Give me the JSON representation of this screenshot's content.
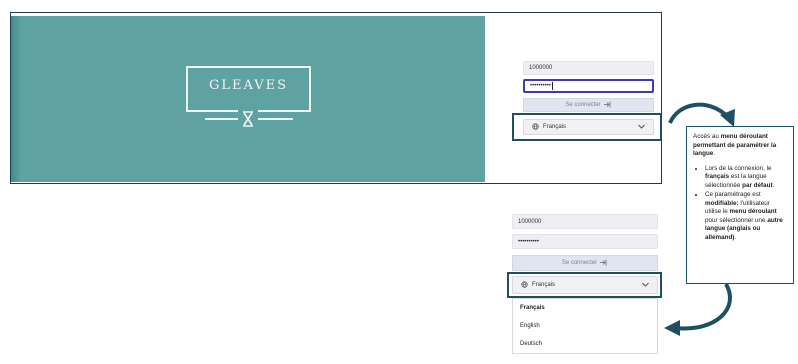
{
  "banner": {
    "brand": "GLEAVES"
  },
  "login_top": {
    "username": "1000000",
    "password": "••••••••••",
    "connect_label": "Se connecter",
    "language": "Français"
  },
  "login_bottom": {
    "username": "1000000",
    "password": "••••••••••",
    "connect_label": "Se connecter",
    "language": "Français",
    "options": [
      "Français",
      "English",
      "Deutsch"
    ]
  },
  "callout": {
    "p_pre": "Accès au ",
    "p_bold1": "menu déroulant permettant de paramétrer la langue",
    "p_post": ".",
    "b1_pre": "Lors de la connexion, le ",
    "b1_bold1": "français",
    "b1_mid": " est la langue sélectionnée ",
    "b1_bold2": "par défaut",
    "b1_post": ".",
    "b2_pre": "Ce paramétrage est ",
    "b2_bold1": "modifiable:",
    "b2_mid1": " l'utilisateur utilise le ",
    "b2_bold2": "menu déroulant",
    "b2_mid2": " pour sélectionner une ",
    "b2_bold3": "autre langue (anglais ou allemand)",
    "b2_post": "."
  },
  "colors": {
    "banner": "#5ea3a1",
    "highlight": "#1f4f63",
    "focus": "#3b3bb8"
  },
  "icons": [
    "logo-hourglass-icon",
    "login-arrow-icon",
    "globe-icon",
    "chevron-down-icon",
    "curved-arrow-icon"
  ]
}
